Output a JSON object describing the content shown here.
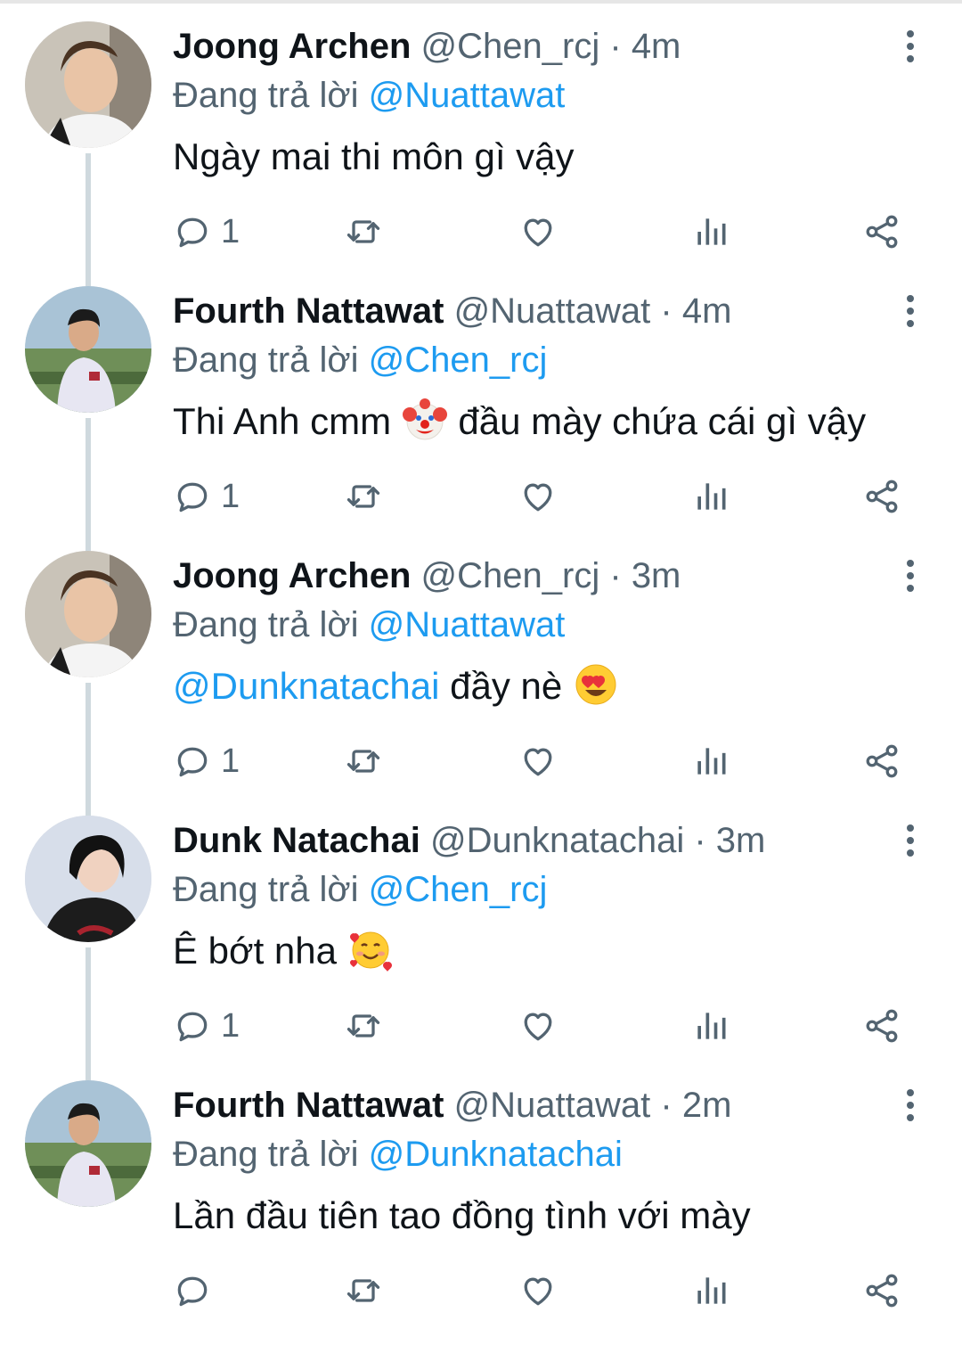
{
  "replying_prefix": "Đang trả lời",
  "colors": {
    "accent": "#1d9bf0",
    "muted": "#536471",
    "text": "#0f1419",
    "thread_line": "#cfd9de"
  },
  "tweets": [
    {
      "name": "Joong Archen",
      "handle": "@Chen_rcj",
      "separator": "·",
      "time": "4m",
      "reply_to": "@Nuattawat",
      "text": "Ngày mai thi môn gì vậy",
      "reply_count": "1",
      "avatar": "avatar-joong"
    },
    {
      "name": "Fourth Nattawat",
      "handle": "@Nuattawat",
      "separator": "·",
      "time": "4m",
      "reply_to": "@Chen_rcj",
      "text_before": "Thi Anh cmm",
      "emoji": "clown-face-emoji",
      "text_after": "đầu mày chứa cái gì vậy",
      "reply_count": "1",
      "avatar": "avatar-fourth"
    },
    {
      "name": "Joong Archen",
      "handle": "@Chen_rcj",
      "separator": "·",
      "time": "3m",
      "reply_to": "@Nuattawat",
      "mention": "@Dunknatachai",
      "text_after": "đầy nè",
      "emoji": "heart-eyes-emoji",
      "reply_count": "1",
      "avatar": "avatar-joong"
    },
    {
      "name": "Dunk Natachai",
      "handle": "@Dunknatachai",
      "separator": "·",
      "time": "3m",
      "reply_to": "@Chen_rcj",
      "text_before": "Ê bớt nha",
      "emoji": "smiling-face-with-hearts-emoji",
      "reply_count": "1",
      "avatar": "avatar-dunk"
    },
    {
      "name": "Fourth Nattawat",
      "handle": "@Nuattawat",
      "separator": "·",
      "time": "2m",
      "reply_to": "@Dunknatachai",
      "text": "Lần đầu tiên tao đồng tình với mày",
      "reply_count": "",
      "avatar": "avatar-fourth"
    }
  ],
  "icons": [
    "reply-icon",
    "retweet-icon",
    "like-icon",
    "views-icon",
    "share-icon",
    "more-options-icon"
  ]
}
